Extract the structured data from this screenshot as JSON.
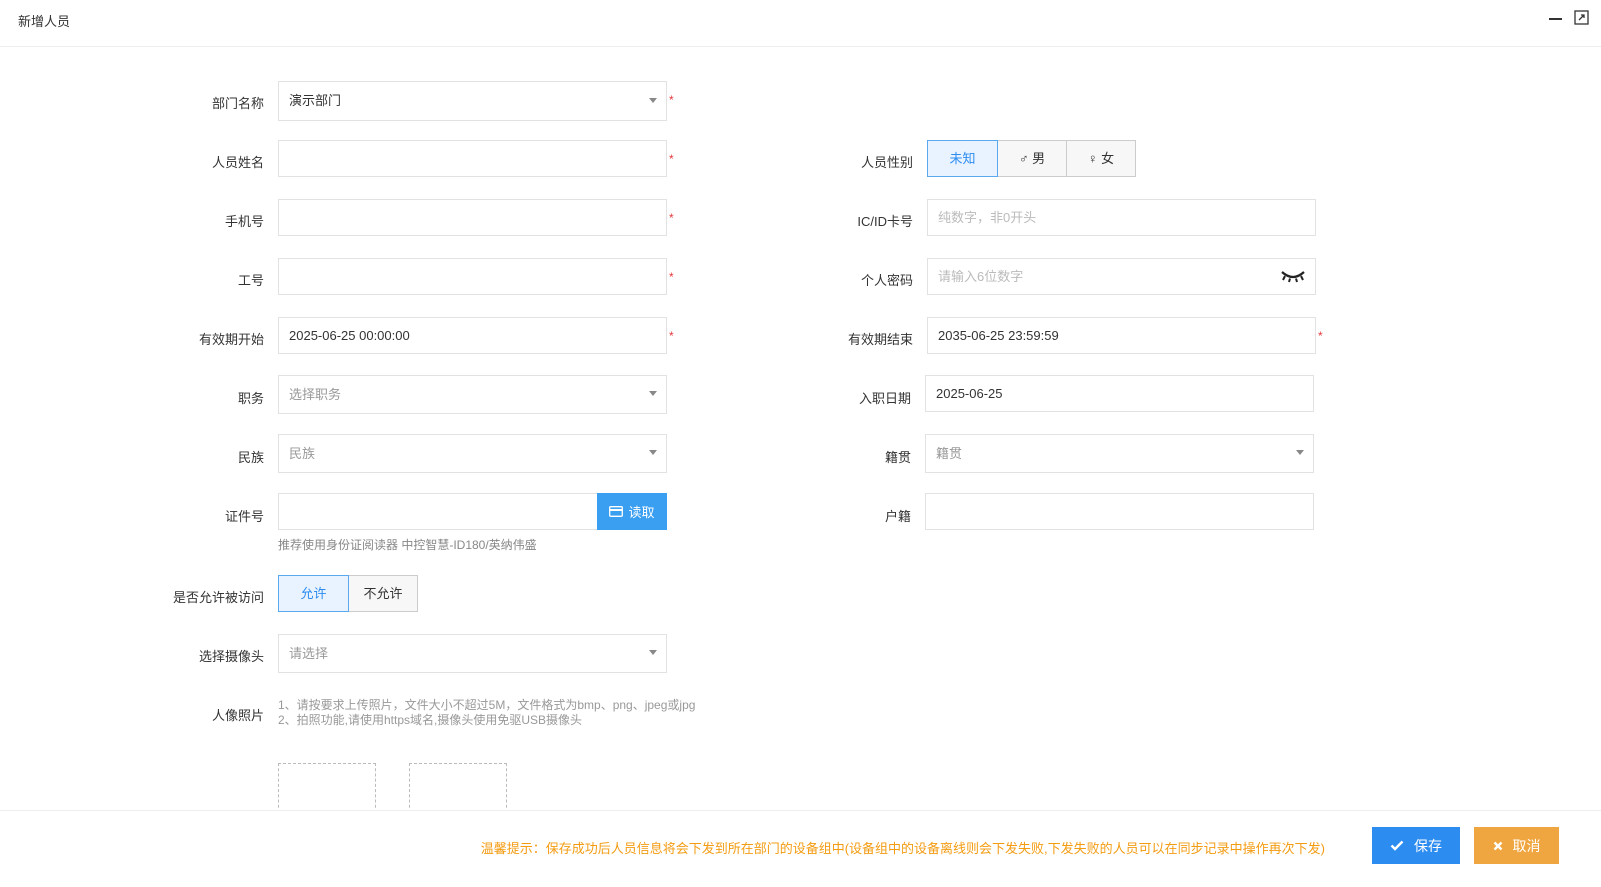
{
  "window": {
    "title": "新增人员"
  },
  "form": {
    "dept": {
      "label": "部门名称",
      "value": "演示部门"
    },
    "name": {
      "label": "人员姓名",
      "value": "",
      "placeholder": ""
    },
    "gender": {
      "label": "人员性别",
      "options": [
        "未知",
        "♂ 男",
        "♀ 女"
      ],
      "selected": "未知"
    },
    "phone": {
      "label": "手机号",
      "value": "",
      "placeholder": ""
    },
    "card": {
      "label": "IC/ID卡号",
      "value": "",
      "placeholder": "纯数字，非0开头"
    },
    "work_no": {
      "label": "工号",
      "value": "",
      "placeholder": ""
    },
    "password": {
      "label": "个人密码",
      "value": "",
      "placeholder": "请输入6位数字"
    },
    "valid_start": {
      "label": "有效期开始",
      "value": "2025-06-25 00:00:00"
    },
    "valid_end": {
      "label": "有效期结束",
      "value": "2035-06-25 23:59:59"
    },
    "position": {
      "label": "职务",
      "placeholder": "选择职务"
    },
    "hire_date": {
      "label": "入职日期",
      "value": "2025-06-25"
    },
    "nation": {
      "label": "民族",
      "placeholder": "民族"
    },
    "native": {
      "label": "籍贯",
      "placeholder": "籍贯"
    },
    "id_no": {
      "label": "证件号",
      "value": "",
      "placeholder": "",
      "read_label": "读取",
      "hint": "推荐使用身份证阅读器 中控智慧-ID180/英纳伟盛"
    },
    "household": {
      "label": "户籍",
      "value": "",
      "placeholder": ""
    },
    "visitable": {
      "label": "是否允许被访问",
      "options": [
        "允许",
        "不允许"
      ],
      "selected": "允许"
    },
    "camera": {
      "label": "选择摄像头",
      "placeholder": "请选择"
    },
    "photo": {
      "label": "人像照片",
      "hint1": "1、请按要求上传照片，文件大小不超过5M，文件格式为bmp、png、jpeg或jpg",
      "hint2": "2、拍照功能,请使用https域名,摄像头使用免驱USB摄像头"
    },
    "required_mark": "*"
  },
  "footer": {
    "tip": "温馨提示：保存成功后人员信息将会下发到所在部门的设备组中(设备组中的设备离线则会下发失败,下发失败的人员可以在同步记录中操作再次下发)",
    "save_label": "保存",
    "cancel_label": "取消"
  },
  "colors": {
    "primary": "#2d8cf0",
    "warning": "#f0a640",
    "required": "#e4393c",
    "tip": "#f39c12"
  }
}
